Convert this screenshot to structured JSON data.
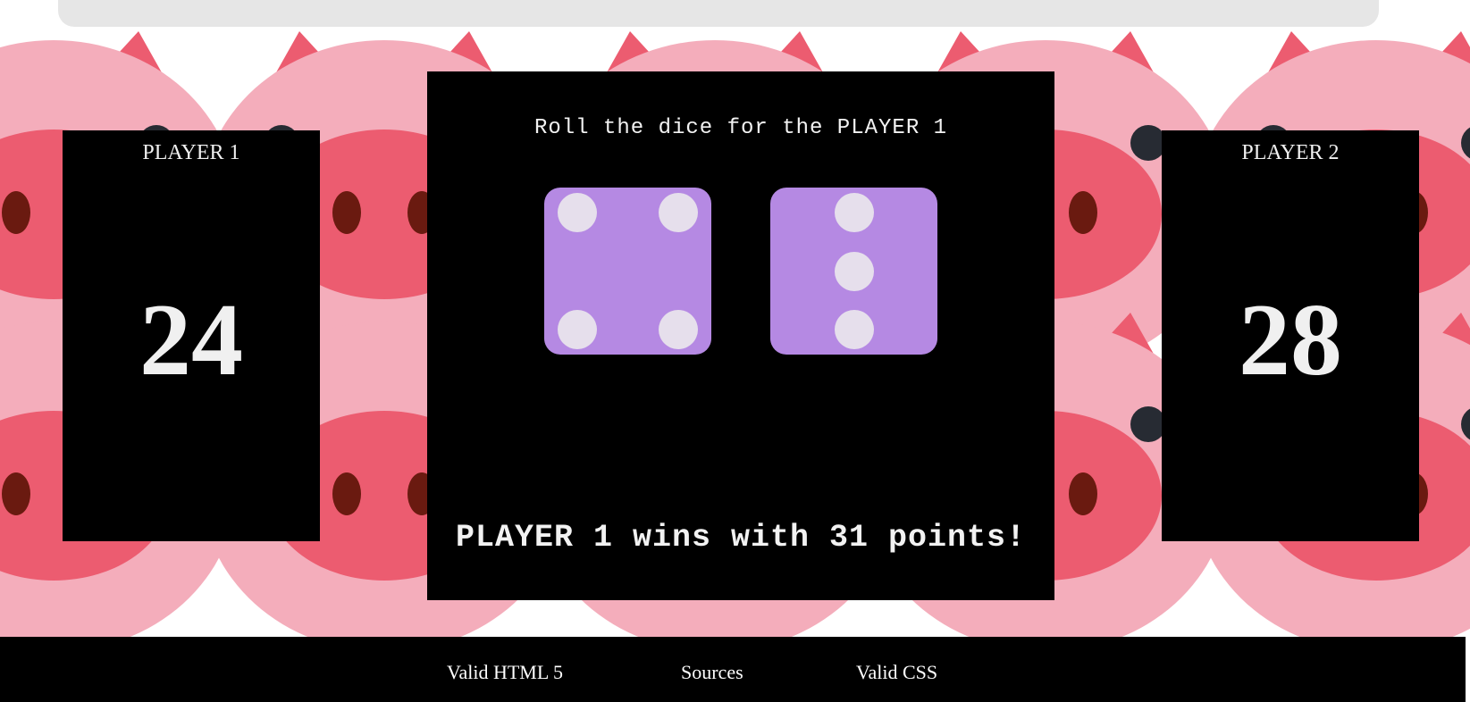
{
  "players": [
    {
      "name": "PLAYER 1",
      "score": "24"
    },
    {
      "name": "PLAYER 2",
      "score": "28"
    }
  ],
  "board": {
    "prompt": "Roll the dice for the PLAYER 1",
    "dice": [
      4,
      3
    ],
    "result": "PLAYER 1 wins with 31 points!"
  },
  "footer": {
    "links": [
      "Valid HTML 5",
      "Sources",
      "Valid CSS"
    ]
  },
  "colors": {
    "die_face": "#b589e3",
    "pip": "#e6dfec",
    "panel": "#000000",
    "pig_light": "#f4adbb",
    "pig_dark": "#ec5c70",
    "pig_nostril": "#6a1a10",
    "pig_eye": "#272b33"
  },
  "icons": {
    "background": "pig-face-icon"
  }
}
